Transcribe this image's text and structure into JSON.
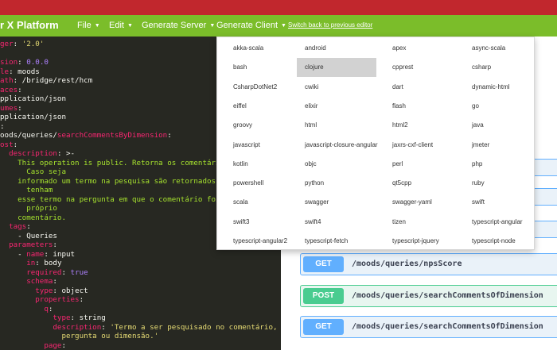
{
  "header": {
    "brand": "r X Platform",
    "menus": [
      {
        "label": "File"
      },
      {
        "label": "Edit"
      },
      {
        "label": "Generate Server"
      },
      {
        "label": "Generate Client"
      }
    ],
    "switch_link": "Switch back to previous editor"
  },
  "editor": {
    "lines": [
      [
        {
          "t": "ger",
          "c": "k"
        },
        {
          "t": ": ",
          "c": "w"
        },
        {
          "t": "'2.0'",
          "c": "s"
        }
      ],
      [],
      [
        {
          "t": "sion",
          "c": "k"
        },
        {
          "t": ": ",
          "c": "w"
        },
        {
          "t": "0.0.0",
          "c": "n"
        }
      ],
      [
        {
          "t": "le",
          "c": "k"
        },
        {
          "t": ": moods",
          "c": "w"
        }
      ],
      [
        {
          "t": "ath",
          "c": "k"
        },
        {
          "t": ": /bridge/rest/hcm",
          "c": "w"
        }
      ],
      [
        {
          "t": "aces",
          "c": "k"
        },
        {
          "t": ":",
          "c": "w"
        }
      ],
      [
        {
          "t": "pplication/json",
          "c": "w"
        }
      ],
      [
        {
          "t": "umes",
          "c": "k"
        },
        {
          "t": ":",
          "c": "w"
        }
      ],
      [
        {
          "t": "pplication/json",
          "c": "w"
        }
      ],
      [
        {
          "t": ":",
          "c": "w"
        }
      ],
      [
        {
          "t": "oods/queries/",
          "c": "w"
        },
        {
          "t": "searchCommentsByDimension",
          "c": "k"
        },
        {
          "t": ":",
          "c": "w"
        }
      ],
      [
        {
          "t": "ost",
          "c": "k"
        },
        {
          "t": ":",
          "c": "w"
        }
      ],
      [
        {
          "t": "  ",
          "c": "w"
        },
        {
          "t": "description",
          "c": "k"
        },
        {
          "t": ": >-",
          "c": "w"
        }
      ],
      [
        {
          "t": "    This operation is public. Retorna os comentários p",
          "c": "c"
        }
      ],
      [
        {
          "t": "      Caso seja",
          "c": "c"
        }
      ],
      [
        {
          "t": "    informado um termo na pesquisa são retornados o c",
          "c": "c"
        }
      ],
      [
        {
          "t": "      tenham",
          "c": "c"
        }
      ],
      [
        {
          "t": "    esse termo na pergunta em que o comentário foi fei",
          "c": "c"
        }
      ],
      [
        {
          "t": "      próprio",
          "c": "c"
        }
      ],
      [
        {
          "t": "    comentário.",
          "c": "c"
        }
      ],
      [
        {
          "t": "  ",
          "c": "w"
        },
        {
          "t": "tags",
          "c": "k"
        },
        {
          "t": ":",
          "c": "w"
        }
      ],
      [
        {
          "t": "    - Queries",
          "c": "w"
        }
      ],
      [
        {
          "t": "  ",
          "c": "w"
        },
        {
          "t": "parameters",
          "c": "k"
        },
        {
          "t": ":",
          "c": "w"
        }
      ],
      [
        {
          "t": "    - ",
          "c": "w"
        },
        {
          "t": "name",
          "c": "k"
        },
        {
          "t": ": input",
          "c": "w"
        }
      ],
      [
        {
          "t": "      ",
          "c": "w"
        },
        {
          "t": "in",
          "c": "k"
        },
        {
          "t": ": body",
          "c": "w"
        }
      ],
      [
        {
          "t": "      ",
          "c": "w"
        },
        {
          "t": "required",
          "c": "k"
        },
        {
          "t": ": ",
          "c": "w"
        },
        {
          "t": "true",
          "c": "n"
        }
      ],
      [
        {
          "t": "      ",
          "c": "w"
        },
        {
          "t": "schema",
          "c": "k"
        },
        {
          "t": ":",
          "c": "w"
        }
      ],
      [
        {
          "t": "        ",
          "c": "w"
        },
        {
          "t": "type",
          "c": "k"
        },
        {
          "t": ": object",
          "c": "w"
        }
      ],
      [
        {
          "t": "        ",
          "c": "w"
        },
        {
          "t": "properties",
          "c": "k"
        },
        {
          "t": ":",
          "c": "w"
        }
      ],
      [
        {
          "t": "          ",
          "c": "w"
        },
        {
          "t": "q",
          "c": "k"
        },
        {
          "t": ":",
          "c": "w"
        }
      ],
      [
        {
          "t": "            ",
          "c": "w"
        },
        {
          "t": "type",
          "c": "k"
        },
        {
          "t": ": string",
          "c": "w"
        }
      ],
      [
        {
          "t": "            ",
          "c": "w"
        },
        {
          "t": "description",
          "c": "k"
        },
        {
          "t": ": ",
          "c": "w"
        },
        {
          "t": "'Termo a ser pesquisado no comentário,",
          "c": "s"
        }
      ],
      [
        {
          "t": "              pergunta ou dimensão.'",
          "c": "s"
        }
      ],
      [
        {
          "t": "          ",
          "c": "w"
        },
        {
          "t": "page",
          "c": "k"
        },
        {
          "t": ":",
          "c": "w"
        }
      ]
    ]
  },
  "operations": [
    {
      "method": "GET",
      "path": "/moods/queries/npsScore"
    },
    {
      "method": "POST",
      "path": "/moods/queries/searchCommentsOfDimension"
    },
    {
      "method": "GET",
      "path": "/moods/queries/searchCommentsOfDimension"
    }
  ],
  "dropdown": {
    "columns": [
      [
        "akka-scala",
        "bash",
        "CsharpDotNet2",
        "eiffel",
        "groovy",
        "javascript",
        "kotlin",
        "powershell",
        "scala",
        "swift3",
        "typescript-angular2"
      ],
      [
        "android",
        "clojure",
        "cwiki",
        "elixir",
        "html",
        "javascript-closure-angular",
        "objc",
        "python",
        "swagger",
        "swift4",
        "typescript-fetch"
      ],
      [
        "apex",
        "cpprest",
        "dart",
        "flash",
        "html2",
        "jaxrs-cxf-client",
        "perl",
        "qt5cpp",
        "swagger-yaml",
        "tizen",
        "typescript-jquery"
      ],
      [
        "async-scala",
        "csharp",
        "dynamic-html",
        "go",
        "java",
        "jmeter",
        "php",
        "ruby",
        "swift",
        "typescript-angular",
        "typescript-node"
      ]
    ],
    "highlighted": "clojure"
  },
  "colors": {
    "red_bar": "#c1272d",
    "nav_green": "#7bbd2a",
    "editor_bg": "#272822",
    "get": "#61affe",
    "post": "#49cc90"
  }
}
